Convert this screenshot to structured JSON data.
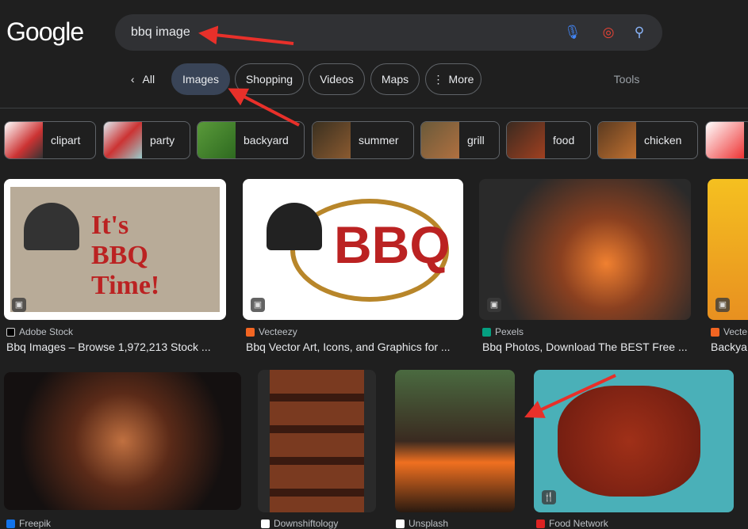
{
  "header": {
    "logo": "Google",
    "query": "bbq image"
  },
  "tabs": [
    {
      "label": "All"
    },
    {
      "label": "Images",
      "selected": true
    },
    {
      "label": "Shopping"
    },
    {
      "label": "Videos"
    },
    {
      "label": "Maps"
    },
    {
      "label": "More"
    }
  ],
  "tools_label": "Tools",
  "chips": [
    "clipart",
    "party",
    "backyard",
    "summer",
    "grill",
    "food",
    "chicken"
  ],
  "results_row1": [
    {
      "source": "Adobe Stock",
      "title": "Bbq Images – Browse 1,972,213 Stock ..."
    },
    {
      "source": "Vecteezy",
      "title": "Bbq Vector Art, Icons, and Graphics for ..."
    },
    {
      "source": "Pexels",
      "title": "Bbq Photos, Download The BEST Free ..."
    },
    {
      "source": "Vecte",
      "title": "Backya"
    }
  ],
  "results_row2": [
    {
      "source": "Freepik"
    },
    {
      "source": "Downshiftology"
    },
    {
      "source": "Unsplash"
    },
    {
      "source": "Food Network"
    }
  ],
  "colors": {
    "background": "#1f1f1f",
    "selected_tab": "#394457",
    "annotation_arrow": "#e8302a"
  }
}
